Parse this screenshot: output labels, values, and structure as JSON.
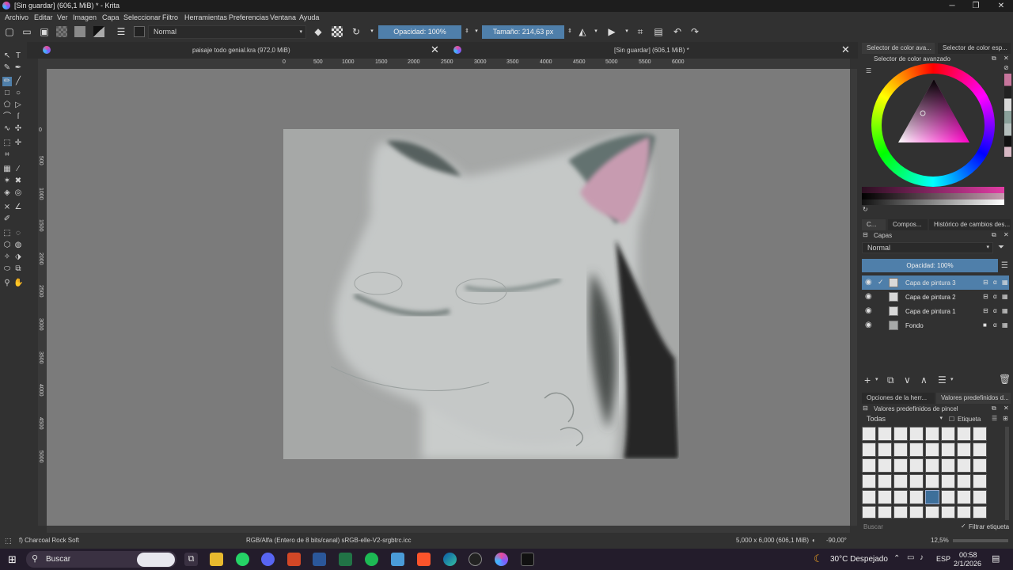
{
  "window": {
    "title": "[Sin guardar]  (606,1 MiB) * - Krita",
    "minimize": "─",
    "maximize": "❐",
    "close": "✕"
  },
  "menu": [
    "Archivo",
    "Editar",
    "Ver",
    "Imagen",
    "Capa",
    "Seleccionar",
    "Filtro",
    "Herramientas",
    "Preferencias",
    "Ventana",
    "Ayuda"
  ],
  "toolbar": {
    "blend_mode": "Normal",
    "opacity": "Opacidad: 100%",
    "size": "Tamaño: 214,63 px"
  },
  "tabs": [
    {
      "label": "paisaje todo genial.kra (972,0 MiB)"
    },
    {
      "label": "[Sin guardar]  (606,1 MiB) *"
    }
  ],
  "ruler": {
    "x": [
      "0",
      "500",
      "1000",
      "1500",
      "2000",
      "2500",
      "3000",
      "3500",
      "4000",
      "4500",
      "5000",
      "5500",
      "6000"
    ],
    "y": [
      "0",
      "500",
      "1000",
      "1500",
      "2000",
      "2500",
      "3000",
      "3500",
      "4000",
      "4500",
      "5000"
    ]
  },
  "right_panel": {
    "top_tabs": [
      "Selector de color ava...",
      "Selector de color esp..."
    ],
    "color_selector_title": "Selector de color avanzado",
    "mid_tabs": [
      "C...",
      "Compos...",
      "Histórico de cambios des..."
    ],
    "layers_title": "Capas",
    "layers_blend": "Normal",
    "layers_opacity": "Opacidad:  100%",
    "layers": [
      {
        "name": "Capa de pintura 3",
        "selected": true
      },
      {
        "name": "Capa de pintura 2",
        "selected": false
      },
      {
        "name": "Capa de pintura 1",
        "selected": false
      },
      {
        "name": "Fondo",
        "selected": false
      }
    ],
    "bottom_tabs": [
      "Opciones de la herr...",
      "Valores predefinidos d..."
    ],
    "presets_title": "Valores predefinidos de pincel",
    "presets_filter": "Todas",
    "presets_tag": "Etiqueta",
    "search_placeholder": "Buscar",
    "filter_tag": "Filtrar etiqueta"
  },
  "status": {
    "brush": "f) Charcoal Rock Soft",
    "color_model": "RGB/Alfa (Entero de 8 bits/canal)  sRGB-elle-V2-srgbtrc.icc",
    "dimensions": "5,000 x 6,000 (606,1 MiB)",
    "rotation": "-90,00°",
    "zoom": "12,5%"
  },
  "taskbar": {
    "search": "Buscar",
    "weather": "30°C  Despejado",
    "lang": "ESP",
    "time": "00:58",
    "date": "2/1/2026"
  },
  "colors": {
    "accent": "#4f7faa",
    "canvas_bg": "#7b7b7b",
    "panel_bg": "#313131"
  }
}
